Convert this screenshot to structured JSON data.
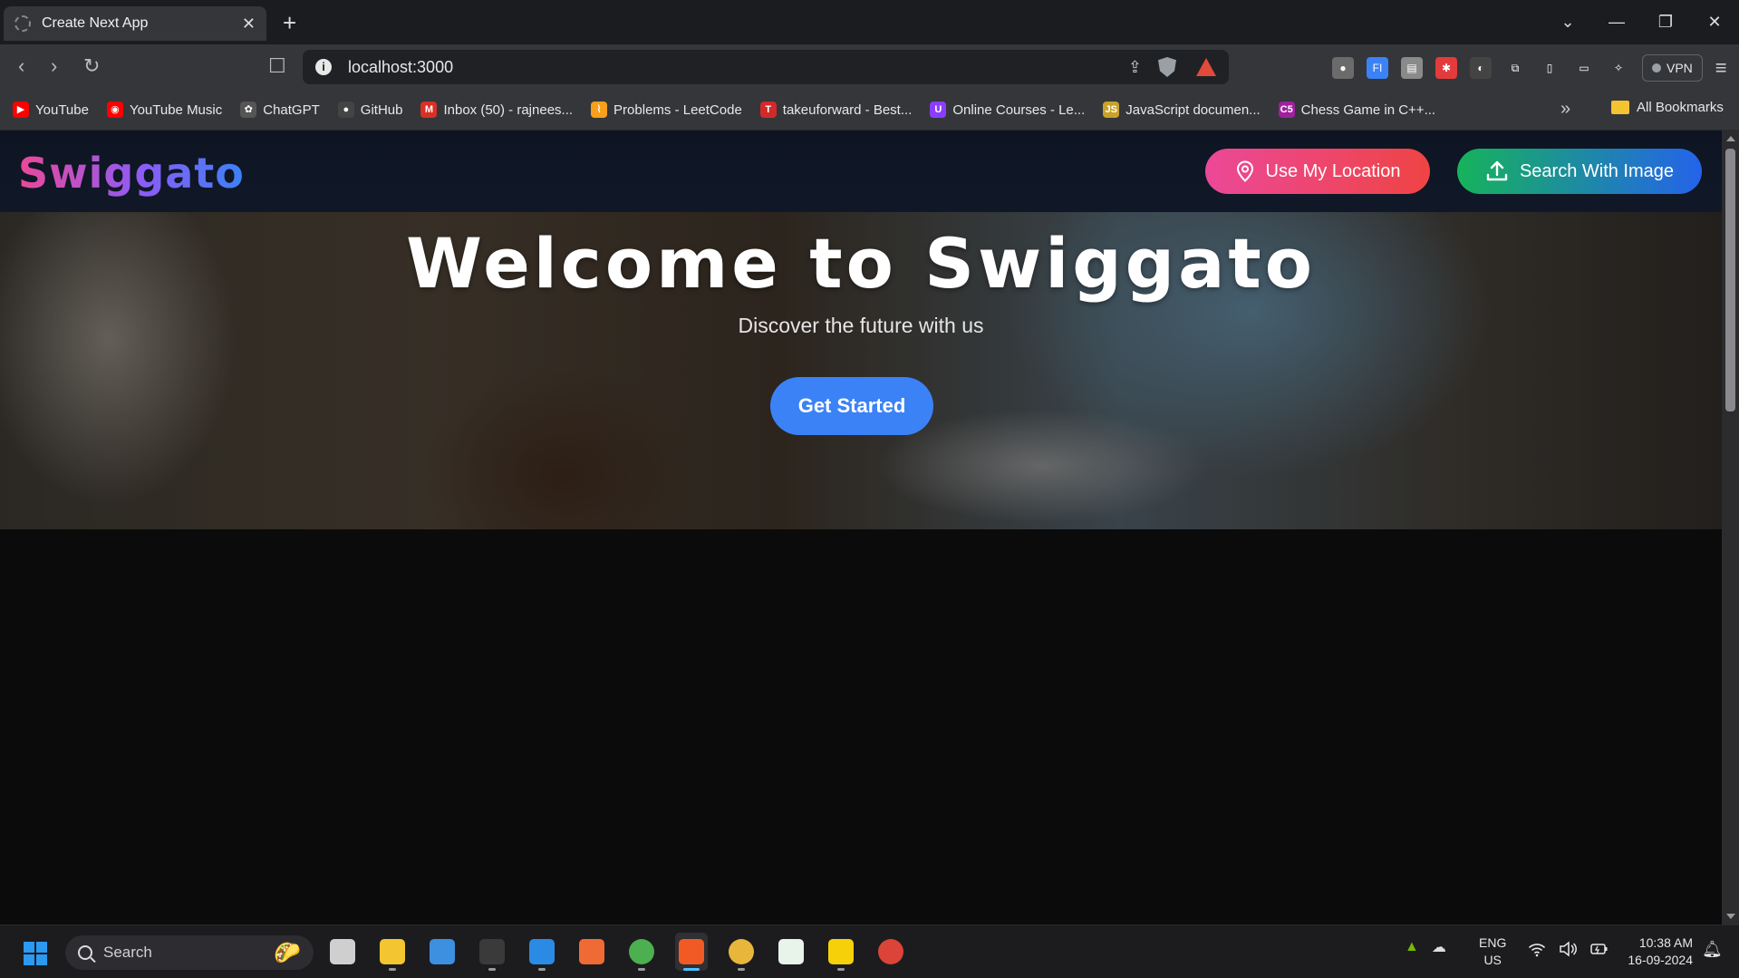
{
  "browser": {
    "tab": {
      "title": "Create Next App",
      "close": "✕"
    },
    "new_tab": "+",
    "window_controls": {
      "dropdown": "⌄",
      "minimize": "—",
      "restore": "❐",
      "close": "✕"
    },
    "nav": {
      "back": "‹",
      "forward": "›",
      "reload": "↻",
      "bookmark": "☐"
    },
    "url": "localhost:3000",
    "info_icon": "i",
    "vpn_label": "VPN",
    "menu": "≡"
  },
  "extensions": [
    {
      "icon": "mouse-icon",
      "label": "●",
      "color": "#6b6b6b"
    },
    {
      "icon": "fi-extension-icon",
      "label": "FI",
      "color": "#3b82f6"
    },
    {
      "icon": "cards-extension-icon",
      "label": "▤",
      "color": "#8a8a8a"
    },
    {
      "icon": "red-extension-icon",
      "label": "✱",
      "color": "#e33b3b"
    },
    {
      "icon": "dark-extension-icon",
      "label": "◐",
      "color": "#444444"
    },
    {
      "icon": "puzzle-icon",
      "label": "⧉",
      "color": "#35363a"
    },
    {
      "icon": "sidebar-icon",
      "label": "▯",
      "color": "#35363a"
    },
    {
      "icon": "wallet-icon",
      "label": "▭",
      "color": "#35363a"
    },
    {
      "icon": "leo-ai-icon",
      "label": "✧",
      "color": "#35363a"
    }
  ],
  "bookmarks": [
    {
      "label": "YouTube",
      "icon": "youtube-icon",
      "color": "#ff0000",
      "glyph": "▶"
    },
    {
      "label": "YouTube Music",
      "icon": "youtube-music-icon",
      "color": "#ff0000",
      "glyph": "◉"
    },
    {
      "label": "ChatGPT",
      "icon": "chatgpt-icon",
      "color": "#555555",
      "glyph": "✿"
    },
    {
      "label": "GitHub",
      "icon": "github-icon",
      "color": "#444444",
      "glyph": "●"
    },
    {
      "label": "Inbox (50) - rajnees...",
      "icon": "gmail-icon",
      "color": "#d93025",
      "glyph": "M"
    },
    {
      "label": "Problems - LeetCode",
      "icon": "leetcode-icon",
      "color": "#f89f1b",
      "glyph": "⌇"
    },
    {
      "label": "takeuforward - Best...",
      "icon": "takeuforward-icon",
      "color": "#d12a2a",
      "glyph": "T"
    },
    {
      "label": "Online Courses - Le...",
      "icon": "udemy-icon",
      "color": "#8b3dff",
      "glyph": "U"
    },
    {
      "label": "JavaScript documen...",
      "icon": "javascript-icon",
      "color": "#c9a227",
      "glyph": "JS"
    },
    {
      "label": "Chess Game in C++...",
      "icon": "chess-site-icon",
      "color": "#a020a0",
      "glyph": "C5"
    }
  ],
  "bookmarks_overflow": "»",
  "all_bookmarks": "All Bookmarks",
  "page": {
    "logo": "Swiggato",
    "location_button": "Use My Location",
    "image_button": "Search With Image",
    "hero_title": "Welcome to Swiggato",
    "hero_subtitle": "Discover the future with us",
    "cta": "Get Started"
  },
  "taskbar": {
    "search_placeholder": "Search",
    "apps": [
      {
        "name": "task-view-icon",
        "color": "#cfcfcf",
        "running": false
      },
      {
        "name": "file-explorer-icon",
        "color": "#f3c531",
        "running": true
      },
      {
        "name": "microsoft-store-icon",
        "color": "#3d8fe0",
        "running": false
      },
      {
        "name": "terminal-icon",
        "color": "#3a3a3a",
        "running": true
      },
      {
        "name": "vscode-icon",
        "color": "#2b8ae3",
        "running": true
      },
      {
        "name": "postman-icon",
        "color": "#f06a35",
        "running": false
      },
      {
        "name": "chrome-dev-icon",
        "color": "#4caf50",
        "running": true
      },
      {
        "name": "brave-icon",
        "color": "#f15a24",
        "running": true,
        "active": true
      },
      {
        "name": "chrome-profile-icon",
        "color": "#e8b63a",
        "running": true
      },
      {
        "name": "mongodb-compass-icon",
        "color": "#e8f3ea",
        "running": false
      },
      {
        "name": "sticky-notes-icon",
        "color": "#f6d10a",
        "running": true
      },
      {
        "name": "chrome-icon",
        "color": "#db4437",
        "running": false
      }
    ],
    "tray": [
      "▲",
      "☁"
    ],
    "lang_top": "ENG",
    "lang_bottom": "US",
    "sys_icons": [
      "wifi",
      "volume",
      "battery"
    ],
    "time": "10:38 AM",
    "date": "16-09-2024"
  }
}
